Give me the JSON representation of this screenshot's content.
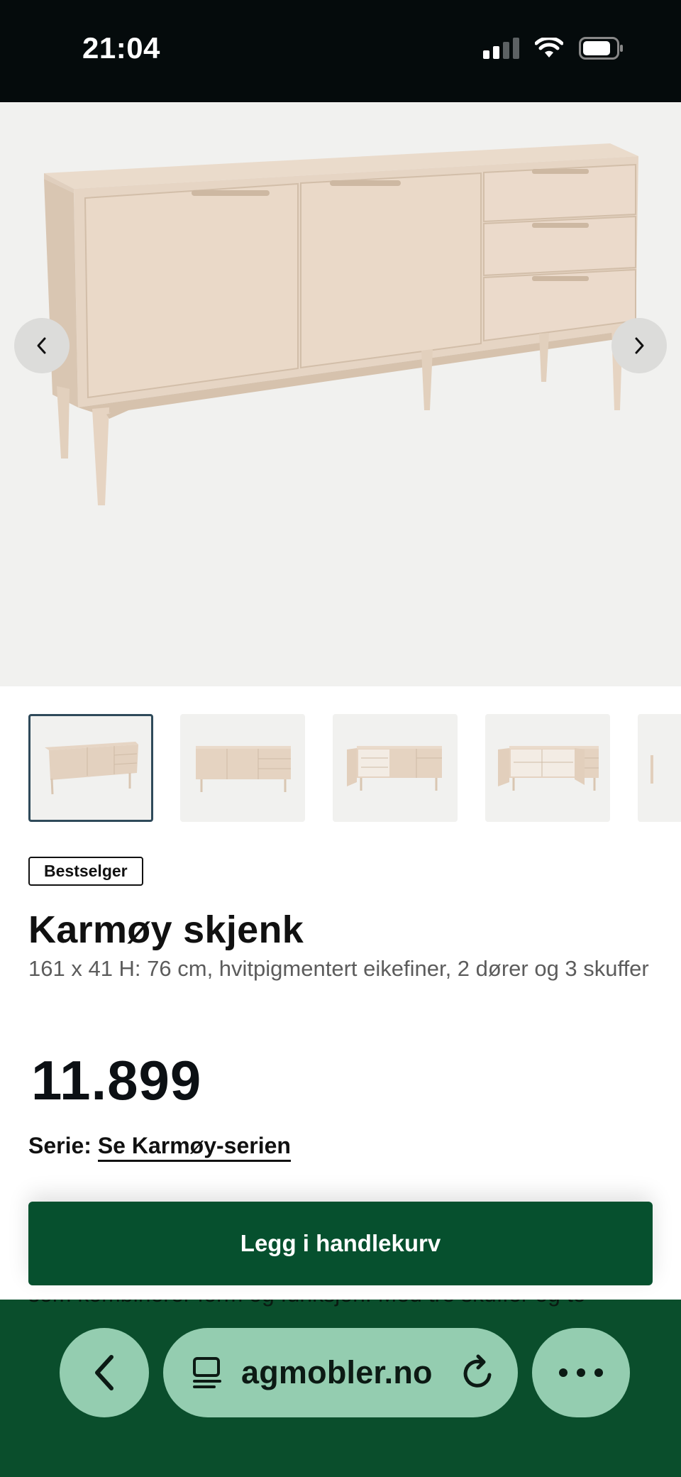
{
  "status_bar": {
    "time": "21:04"
  },
  "gallery": {
    "thumbnail_count_visible": 5,
    "active_index": 0
  },
  "product": {
    "badge": "Bestselger",
    "title": "Karmøy skjenk",
    "description": "161 x 41 H: 76 cm, hvitpigmentert eikefiner, 2 dører og 3 skuffer",
    "price": "11.899",
    "series_label": "Serie:",
    "series_link": "Se Karmøy-serien",
    "add_to_cart": "Legg i handlekurv",
    "body_text_peek": "som kombinerer form og funksjon. Med tre skuffer og to"
  },
  "browser": {
    "url": "agmobler.no"
  },
  "colors": {
    "brand_green": "#06502e",
    "bottom_bar": "#0a4e2c",
    "pill": "#94cdb0",
    "status_bar": "#050b0c"
  }
}
